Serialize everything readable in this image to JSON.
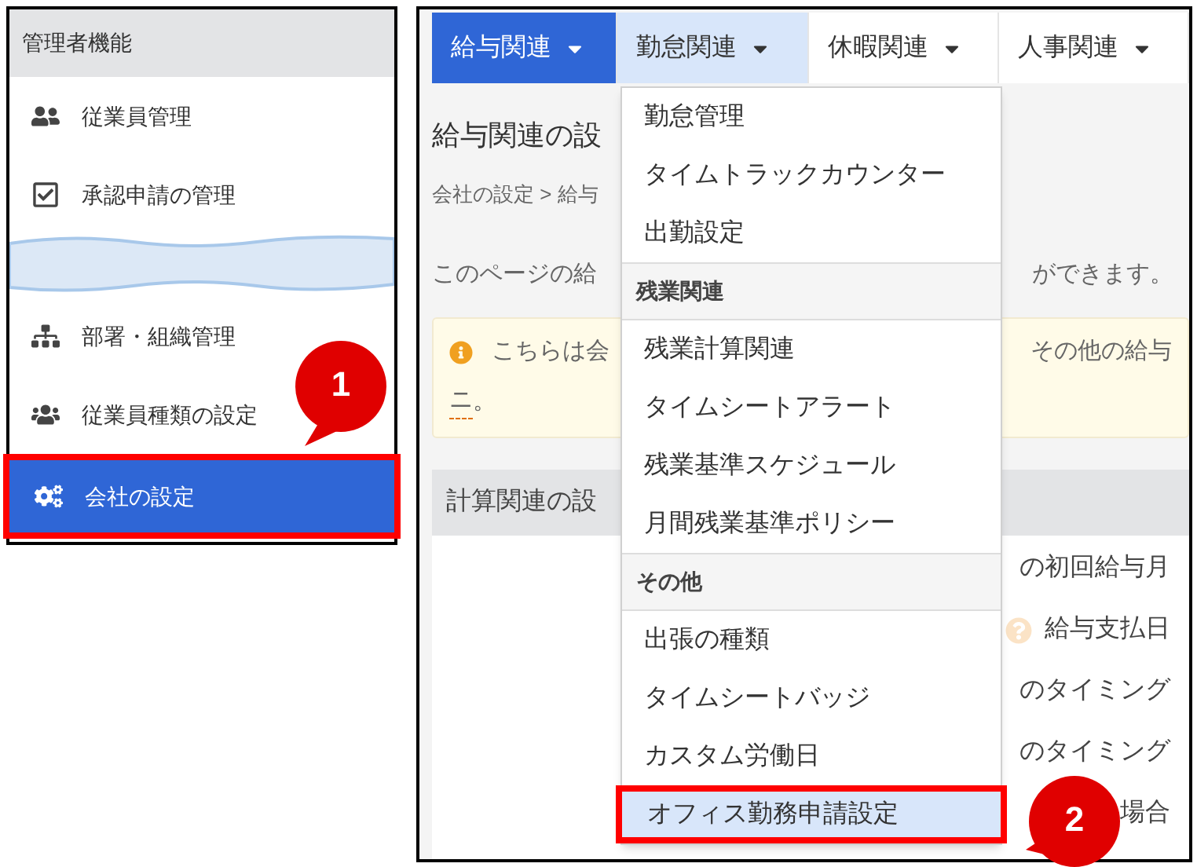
{
  "sidebar": {
    "header": "管理者機能",
    "items": [
      {
        "label": "従業員管理",
        "selected": false,
        "highlighted": false
      },
      {
        "label": "承認申請の管理",
        "selected": false,
        "highlighted": false
      },
      {
        "kind": "break"
      },
      {
        "label": "部署・組織管理",
        "selected": false,
        "highlighted": false
      },
      {
        "label": "従業員種類の設定",
        "selected": false,
        "highlighted": false
      },
      {
        "label": "会社の設定",
        "selected": true,
        "highlighted": true
      }
    ],
    "callout": "1"
  },
  "tabs": [
    {
      "label": "給与関連",
      "selected": true,
      "open": false
    },
    {
      "label": "勤怠関連",
      "selected": false,
      "open": true
    },
    {
      "label": "休暇関連",
      "selected": false,
      "open": false
    },
    {
      "label": "人事関連",
      "selected": false,
      "open": false
    }
  ],
  "page": {
    "title": "給与関連の設",
    "breadcrumb": "会社の設定 > 給与",
    "description_left": "このページの給",
    "description_right": "ができます。",
    "notice": {
      "left": "こちらは会",
      "right": "その他の給与",
      "link": "ニ"
    },
    "notice_end": "。",
    "section": {
      "title": "計算関連の設",
      "rows": [
        {
          "text": "の初回給与月",
          "help": false
        },
        {
          "text": "給与支払日",
          "help": true
        },
        {
          "text": "のタイミング",
          "help": false
        },
        {
          "text": "のタイミング",
          "help": false
        },
        {
          "text": "場合",
          "help": false
        }
      ]
    }
  },
  "dropdown": {
    "items": [
      {
        "kind": "item",
        "label": "勤怠管理",
        "selected": false,
        "highlighted": false
      },
      {
        "kind": "item",
        "label": "タイムトラックカウンター",
        "selected": false,
        "highlighted": false
      },
      {
        "kind": "item",
        "label": "出勤設定",
        "selected": false,
        "highlighted": false
      },
      {
        "kind": "header",
        "label": "残業関連"
      },
      {
        "kind": "item",
        "label": "残業計算関連",
        "selected": false,
        "highlighted": false
      },
      {
        "kind": "item",
        "label": "タイムシートアラート",
        "selected": false,
        "highlighted": false
      },
      {
        "kind": "item",
        "label": "残業基準スケジュール",
        "selected": false,
        "highlighted": false
      },
      {
        "kind": "item",
        "label": "月間残業基準ポリシー",
        "selected": false,
        "highlighted": false
      },
      {
        "kind": "header",
        "label": "その他"
      },
      {
        "kind": "item",
        "label": "出張の種類",
        "selected": false,
        "highlighted": false
      },
      {
        "kind": "item",
        "label": "タイムシートバッジ",
        "selected": false,
        "highlighted": false
      },
      {
        "kind": "item",
        "label": "カスタム労働日",
        "selected": false,
        "highlighted": false
      },
      {
        "kind": "item",
        "label": "オフィス勤務申請設定",
        "selected": true,
        "highlighted": true
      }
    ],
    "callout": "2"
  }
}
